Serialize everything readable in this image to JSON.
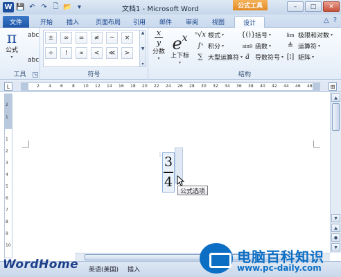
{
  "window": {
    "title": "文档1 - Microsoft Word",
    "context_tab_group": "公式工具",
    "app_icon": "W",
    "minimize": "–",
    "maximize": "□",
    "close": "✕"
  },
  "quick_access": {
    "save": "💾",
    "undo": "↶",
    "redo": "↷",
    "new": "🗋",
    "open": "📂",
    "customize": "▾"
  },
  "tabs": [
    {
      "label": "文件"
    },
    {
      "label": "开始"
    },
    {
      "label": "插入"
    },
    {
      "label": "页面布局"
    },
    {
      "label": "引用"
    },
    {
      "label": "邮件"
    },
    {
      "label": "审阅"
    },
    {
      "label": "视图"
    },
    {
      "label": "设计"
    }
  ],
  "tab_help": {
    "collapse": "△",
    "help": "?"
  },
  "ribbon": {
    "tools": {
      "label": "工具",
      "equation_button": "公式",
      "equation_glyph": "π",
      "professional": "abc",
      "linear": "abc"
    },
    "symbols": {
      "label": "符号",
      "items": [
        "±",
        "∞",
        "=",
        "≠",
        "~",
        "×",
        "÷",
        "!",
        "∝",
        "<",
        "≪",
        ">",
        "≫",
        "≤",
        "≥",
        "∓",
        "≅",
        "≈"
      ],
      "scroll_up": "▲",
      "scroll_down": "▼",
      "more": "▾"
    },
    "structures": {
      "label": "结构",
      "fraction": {
        "label": "分数",
        "num": "x",
        "den": "y"
      },
      "script": {
        "label": "上下标",
        "glyph": "e",
        "sup": "x"
      },
      "radical": "根式",
      "integral": "积分",
      "large_operator": "大型运算符",
      "bracket": "括号",
      "function": "函数",
      "accent": "导数符号",
      "limit": "极限和对数",
      "operator": "运算符",
      "matrix": "矩阵"
    }
  },
  "ruler": {
    "ticks": [
      "2",
      "4",
      "6",
      "8",
      "10",
      "12",
      "14",
      "16",
      "18",
      "20",
      "22",
      "24",
      "26",
      "28",
      "30",
      "32",
      "34",
      "36",
      "38",
      "40",
      "42",
      "44",
      "46",
      "48"
    ],
    "vticks": [
      "2",
      "1",
      "1",
      "2",
      "3",
      "4",
      "5",
      "6",
      "7",
      "8",
      "9",
      "10"
    ],
    "corner": "L"
  },
  "document": {
    "fraction_numerator": "3",
    "fraction_denominator": "4",
    "tooltip": "公式选项"
  },
  "statusbar": {
    "language": "英语(美国)",
    "mode": "插入"
  },
  "watermark": {
    "brand": "WordHome",
    "logo_text": "电脑百科知识",
    "logo_url": "www.pc-daily.com"
  },
  "colors": {
    "accent": "#1f56a8",
    "context": "#e28a24",
    "logo": "#0d6fc4"
  }
}
